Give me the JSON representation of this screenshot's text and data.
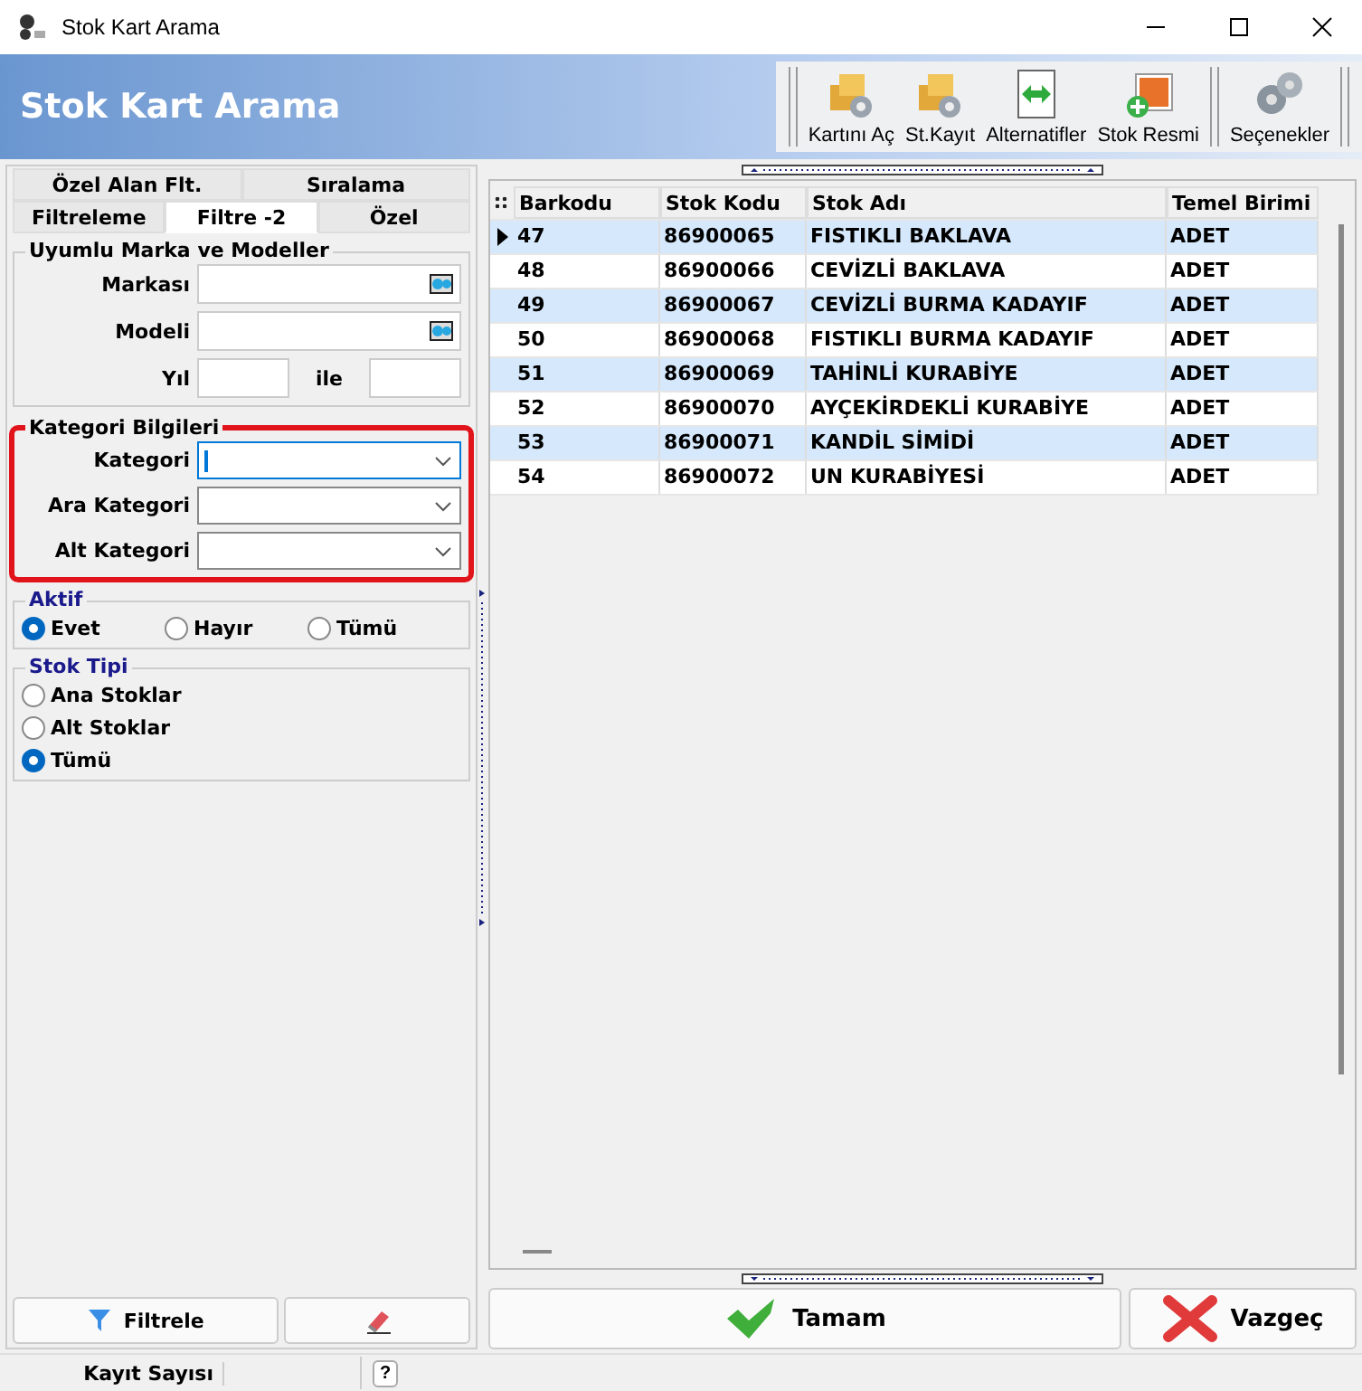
{
  "window": {
    "title": "Stok Kart Arama"
  },
  "header": {
    "title": "Stok Kart Arama"
  },
  "toolbar": [
    {
      "label": "Kartını Aç",
      "kind": "box"
    },
    {
      "label": "St.Kayıt",
      "kind": "box"
    },
    {
      "label": "Alternatifler",
      "kind": "swap"
    },
    {
      "label": "Stok Resmi",
      "kind": "photo"
    },
    {
      "label": "Seçenekler",
      "kind": "gears"
    }
  ],
  "tabs": [
    [
      {
        "label": "Özel Alan Flt.",
        "selected": false
      },
      {
        "label": "Sıralama",
        "selected": false
      }
    ],
    [
      {
        "label": "Filtreleme",
        "selected": false
      },
      {
        "label": "Filtre -2",
        "selected": true
      },
      {
        "label": "Özel",
        "selected": false
      }
    ]
  ],
  "brand_group": {
    "title": "Uyumlu Marka ve Modeller",
    "brand_label": "Markası",
    "model_label": "Modeli",
    "year_label": "Yıl",
    "to_label": "ile"
  },
  "category_group": {
    "title": "Kategori Bilgileri",
    "highlighted": true,
    "fields": [
      {
        "label": "Kategori",
        "focused": true
      },
      {
        "label": "Ara Kategori",
        "focused": false
      },
      {
        "label": "Alt Kategori",
        "focused": false
      }
    ]
  },
  "radio_groups": [
    {
      "title": "Aktif",
      "options": [
        {
          "label": "Evet",
          "selected": true
        },
        {
          "label": "Hayır",
          "selected": false
        },
        {
          "label": "Tümü",
          "selected": false
        }
      ]
    },
    {
      "title": "Stok Tipi",
      "options": [
        {
          "label": "Ana Stoklar",
          "selected": false
        },
        {
          "label": "Alt Stoklar",
          "selected": false
        },
        {
          "label": "Tümü",
          "selected": true
        }
      ]
    }
  ],
  "filter_button": "Filtrele",
  "table": {
    "columns": [
      "Barkodu",
      "Stok Kodu",
      "Stok Adı",
      "Temel Birimi"
    ],
    "rows": [
      {
        "cells": [
          "47",
          "86900065",
          "FISTIKLI BAKLAVA",
          "ADET"
        ],
        "current": true
      },
      {
        "cells": [
          "48",
          "86900066",
          "CEVİZLİ BAKLAVA",
          "ADET"
        ],
        "current": false
      },
      {
        "cells": [
          "49",
          "86900067",
          "CEVİZLİ BURMA KADAYIF",
          "ADET"
        ],
        "current": false
      },
      {
        "cells": [
          "50",
          "86900068",
          "FISTIKLI BURMA KADAYIF",
          "ADET"
        ],
        "current": false
      },
      {
        "cells": [
          "51",
          "86900069",
          "TAHİNLİ KURABİYE",
          "ADET"
        ],
        "current": false
      },
      {
        "cells": [
          "52",
          "86900070",
          "AYÇEKİRDEKLİ KURABİYE",
          "ADET"
        ],
        "current": false
      },
      {
        "cells": [
          "53",
          "86900071",
          "KANDİL SİMİDİ",
          "ADET"
        ],
        "current": false
      },
      {
        "cells": [
          "54",
          "86900072",
          "UN KURABİYESİ",
          "ADET"
        ],
        "current": false
      }
    ]
  },
  "buttons": [
    {
      "label": "Tamam",
      "kind": "ok"
    },
    {
      "label": "Vazgeç",
      "kind": "cancel"
    }
  ],
  "status_bar": {
    "label": "Kayıt Sayısı",
    "help": "?"
  }
}
